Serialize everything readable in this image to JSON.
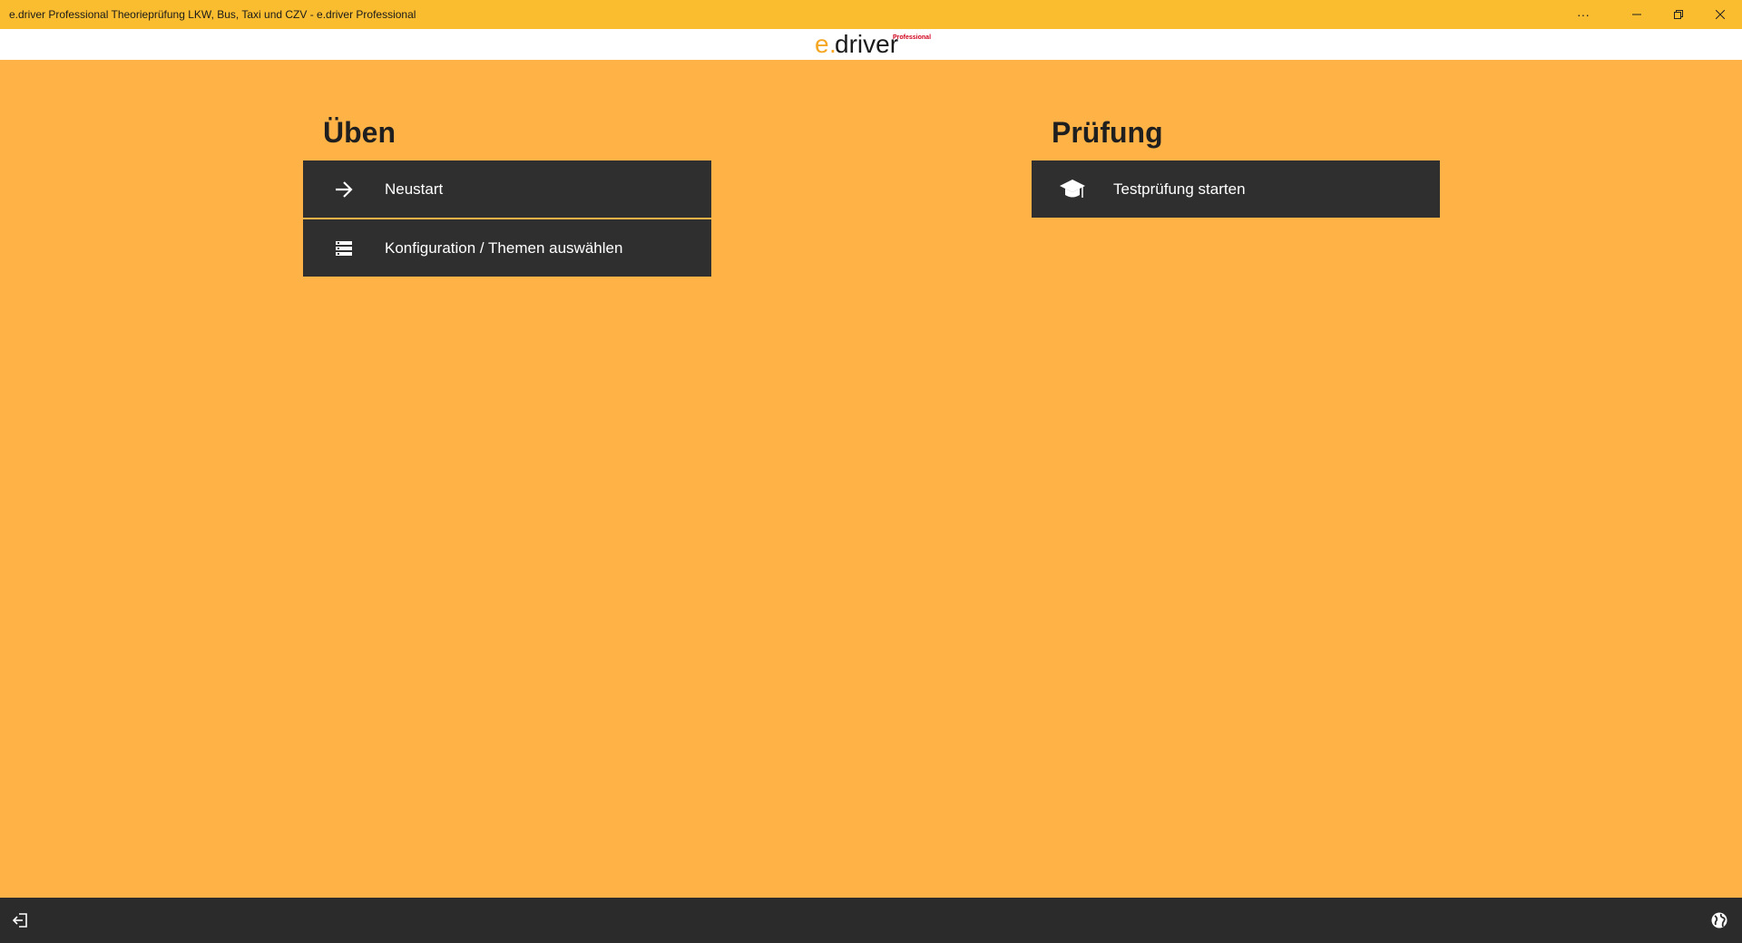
{
  "window": {
    "title": "e.driver Professional Theorieprüfung LKW, Bus, Taxi und CZV - e.driver Professional",
    "controls": [
      "more-icon",
      "minimize-icon",
      "restore-icon",
      "close-icon"
    ]
  },
  "logo": {
    "e": "e",
    "dot": ".",
    "driver": "driver",
    "badge": "Professional",
    "colors": {
      "e": "#F5A623",
      "driver": "#1a1a1a",
      "badge": "#d0021b"
    }
  },
  "practice": {
    "heading": "Üben",
    "items": [
      {
        "label": "Neustart",
        "icon": "arrow-right-icon"
      },
      {
        "label": "Konfiguration / Themen auswählen",
        "icon": "list-icon"
      }
    ]
  },
  "exam": {
    "heading": "Prüfung",
    "items": [
      {
        "label": "Testprüfung starten",
        "icon": "graduation-cap-icon"
      }
    ]
  },
  "bottombar": {
    "left_icon": "logout-icon",
    "right_icon": "globe-icon"
  },
  "colors": {
    "background": "#FFB347",
    "titlebar": "#FBBD30",
    "tile": "#2F2F2F",
    "bottombar": "#2B2B2B"
  }
}
